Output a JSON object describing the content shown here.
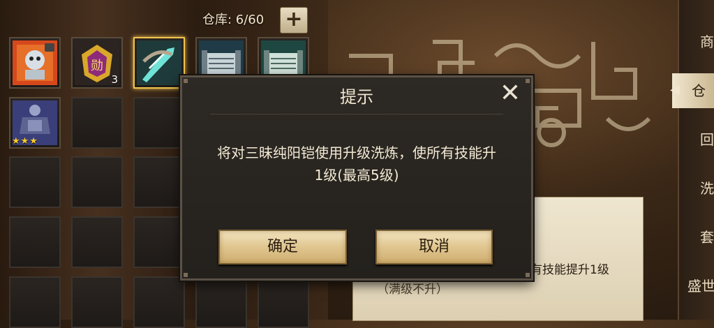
{
  "storage": {
    "label": "仓库: 6/60",
    "add_symbol": "+"
  },
  "inventory": {
    "items": [
      {
        "icon": "armor-fire-skull-icon",
        "qty": ""
      },
      {
        "icon": "medal-badge-icon",
        "qty": "3"
      },
      {
        "icon": "jade-blade-icon",
        "qty": "",
        "selected": true
      },
      {
        "icon": "scroll-blue-icon",
        "qty": ""
      },
      {
        "icon": "scroll-green-icon",
        "qty": ""
      },
      {
        "icon": "dark-armor-icon",
        "qty": "",
        "stars": "★★★"
      }
    ]
  },
  "side_tabs": [
    "商",
    "仓",
    "回",
    "洗",
    "套",
    "盛世"
  ],
  "dialog": {
    "title": "提示",
    "close_symbol": "✕",
    "message_line1": "将对三昧纯阳铠使用升级洗炼，使所有技能升",
    "message_line2": "1级(最高5级)",
    "ok_label": "确定",
    "cancel_label": "取消"
  },
  "background_paper": {
    "text1": "有技能提升1级",
    "text2": "（满级不升）"
  },
  "colors": {
    "accent_gold": "#f0c450",
    "button_tan": "#e0c690"
  }
}
